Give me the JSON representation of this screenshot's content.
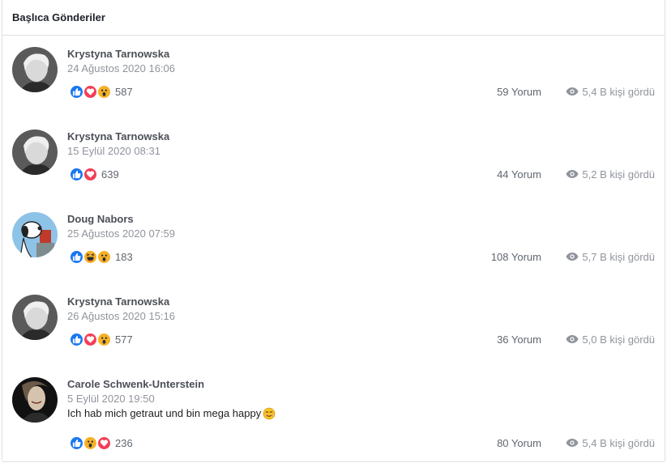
{
  "panel": {
    "title": "Başlıca Gönderiler"
  },
  "colors": {
    "like": "#1877f2",
    "love": "#f33e58",
    "wow": "#f7b125",
    "haha": "#f7b125"
  },
  "posts": [
    {
      "author": "Krystyna Tarnowska",
      "date": "24 Ağustos 2020 16:06",
      "message": "",
      "reactions": [
        "like-icon",
        "love-icon",
        "wow-icon"
      ],
      "reaction_count": "587",
      "comments": "59 Yorum",
      "views": "5,4 B kişi gördü"
    },
    {
      "author": "Krystyna Tarnowska",
      "date": "15 Eylül 2020 08:31",
      "message": "",
      "reactions": [
        "like-icon",
        "love-icon"
      ],
      "reaction_count": "639",
      "comments": "44 Yorum",
      "views": "5,2 B kişi gördü"
    },
    {
      "author": "Doug Nabors",
      "date": "25 Ağustos 2020 07:59",
      "message": "",
      "reactions": [
        "like-icon",
        "haha-icon",
        "wow-icon"
      ],
      "reaction_count": "183",
      "comments": "108 Yorum",
      "views": "5,7 B kişi gördü"
    },
    {
      "author": "Krystyna Tarnowska",
      "date": "26 Ağustos 2020 15:16",
      "message": "",
      "reactions": [
        "like-icon",
        "love-icon",
        "wow-icon"
      ],
      "reaction_count": "577",
      "comments": "36 Yorum",
      "views": "5,0 B kişi gördü"
    },
    {
      "author": "Carole Schwenk-Unterstein",
      "date": "5 Eylül 2020 19:50",
      "message": "Ich hab mich getraut und bin mega happy",
      "reactions": [
        "like-icon",
        "wow-icon",
        "love-icon"
      ],
      "reaction_count": "236",
      "comments": "80 Yorum",
      "views": "5,4 B kişi gördü"
    }
  ]
}
